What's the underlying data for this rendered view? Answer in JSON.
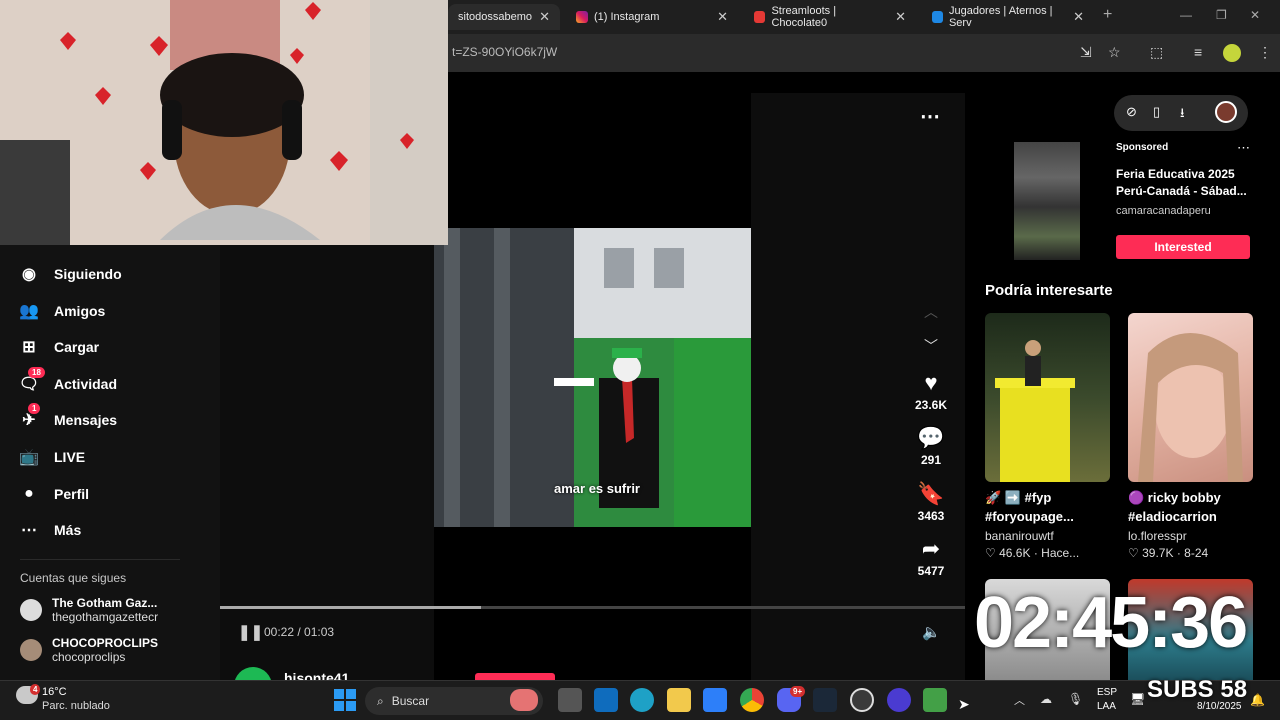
{
  "browser": {
    "tabs": [
      {
        "title": "sitodossabemo",
        "active": true
      },
      {
        "title": "(1) Instagram"
      },
      {
        "title": "Streamloots | Chocolate0"
      },
      {
        "title": "Jugadores | Aternos | Serv"
      }
    ],
    "url_fragment": "t=ZS-90OYiO6k7jW"
  },
  "sidebar": {
    "items": [
      {
        "label": "Siguiendo",
        "icon": "following-avatar-icon"
      },
      {
        "label": "Amigos",
        "icon": "friends-icon"
      },
      {
        "label": "Cargar",
        "icon": "upload-icon"
      },
      {
        "label": "Actividad",
        "icon": "activity-icon",
        "badge": "18"
      },
      {
        "label": "Mensajes",
        "icon": "messages-icon",
        "badge": "1"
      },
      {
        "label": "LIVE",
        "icon": "live-icon"
      },
      {
        "label": "Perfil",
        "icon": "profile-avatar-icon"
      },
      {
        "label": "Más",
        "icon": "more-icon"
      }
    ],
    "following_title": "Cuentas que sigues",
    "following": [
      {
        "name": "The Gotham Gaz...",
        "handle": "thegothamgazettecr"
      },
      {
        "name": "CHOCOPROCLIPS",
        "handle": "chocoproclips"
      }
    ]
  },
  "video": {
    "caption": "amar es sufrir",
    "time": "00:22 / 01:03",
    "progress_fraction": 0.35,
    "author_partial": "hisonte41",
    "actions": {
      "likes": "23.6K",
      "comments": "291",
      "saves": "3463",
      "shares": "5477"
    }
  },
  "ad": {
    "label": "Sponsored",
    "title": "Feria Educativa 2025 Perú-Canadá - Sábad...",
    "advertiser": "camaracanadaperu",
    "cta": "Interested"
  },
  "recommended": {
    "title": "Podría interesarte",
    "cards": [
      {
        "text": "🚀 ➡️ #fyp #foryoupage...",
        "user": "bananirouwtf",
        "likes": "46.6K",
        "date": "Hace..."
      },
      {
        "text": "🟣 ricky bobby #eladiocarrion",
        "user": "lo.floresspr",
        "likes": "39.7K",
        "date": "8-24"
      }
    ]
  },
  "overlay": {
    "clock": "02:45:36",
    "subs": "SUBS 58"
  },
  "taskbar": {
    "weather_temp": "16°C",
    "weather_desc": "Parc. nublado",
    "search_placeholder": "Buscar",
    "lang1": "ESP",
    "lang2": "LAA",
    "date": "8/10/2025",
    "weather_badge": "4",
    "discord_badge": "9+"
  }
}
